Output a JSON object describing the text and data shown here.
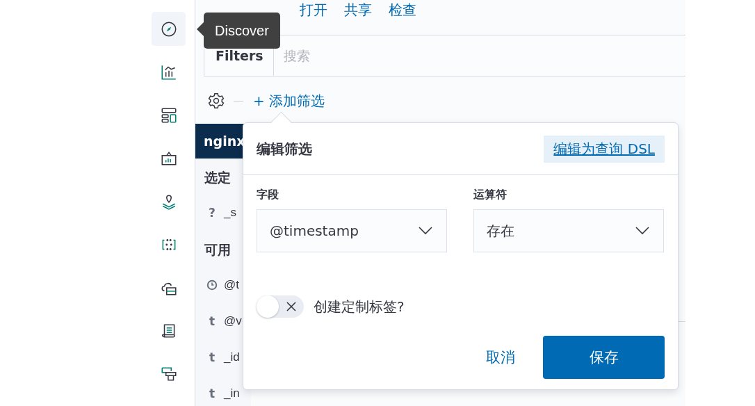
{
  "nav": [
    {
      "selected": true
    },
    {
      "selected": false
    },
    {
      "selected": false
    },
    {
      "selected": false
    },
    {
      "selected": false
    },
    {
      "selected": false
    },
    {
      "selected": false
    },
    {
      "selected": false
    },
    {
      "selected": false
    }
  ],
  "tooltip": {
    "text": "Discover"
  },
  "top_menu": [
    "打开",
    "共享",
    "检查"
  ],
  "query_bar": {
    "label": "Filters",
    "placeholder": "搜索"
  },
  "add_filter": "+ 添加筛选",
  "index_pattern": "nginx",
  "sidebar": [
    {
      "kind": "heading",
      "text": "选定"
    },
    {
      "kind": "field",
      "type_label": "?",
      "text": "_s"
    },
    {
      "kind": "heading",
      "text": "可用"
    },
    {
      "kind": "date_field",
      "text": "@t"
    },
    {
      "kind": "field",
      "type_label": "t",
      "text": "@v"
    },
    {
      "kind": "field",
      "type_label": "t",
      "text": "_id"
    },
    {
      "kind": "field",
      "type_label": "t",
      "text": "_in"
    }
  ],
  "popover": {
    "title": "编辑筛选",
    "dsl_link": "编辑为查询 DSL",
    "field": {
      "label": "字段",
      "value": "@timestamp"
    },
    "operator": {
      "label": "运算符",
      "value": "存在"
    },
    "custom_label": {
      "on": false,
      "label": "创建定制标签?"
    },
    "cancel": "取消",
    "save": "保存"
  }
}
